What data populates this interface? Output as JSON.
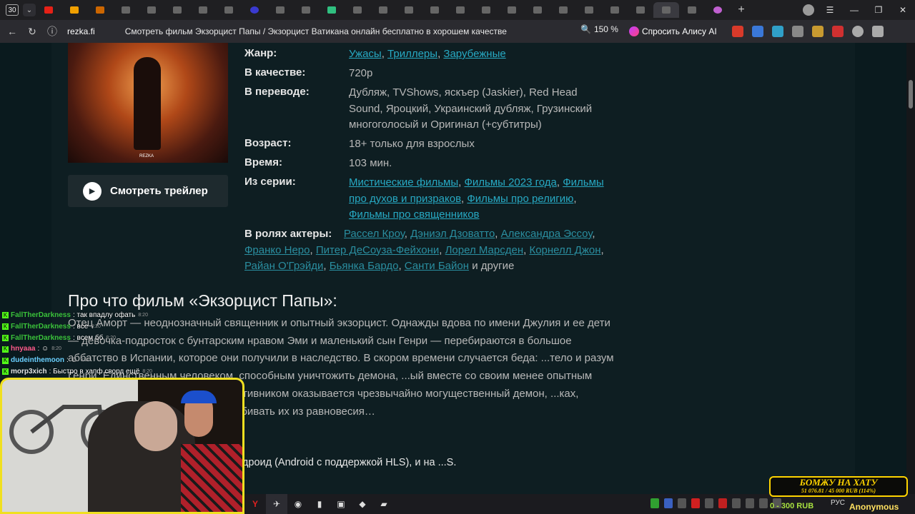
{
  "browser": {
    "tab_count": "30",
    "domain": "rezka.fi",
    "title": "Смотреть фильм Экзорцист Папы / Экзорцист Ватикана онлайн бесплатно в хорошем качестве",
    "zoom": "150 %",
    "alice_label": "Спросить Алису AI"
  },
  "movie": {
    "poster_logo": "REZKA",
    "trailer_label": "Смотреть трейлер",
    "genre_label": "Жанр:",
    "genres": [
      "Ужасы",
      "Триллеры",
      "Зарубежные"
    ],
    "quality_label": "В качестве:",
    "quality": "720p",
    "translation_label": "В переводе:",
    "translation": "Дубляж, TVShows, яскъер (Jaskier), Red Head Sound, Яроцкий, Украинский дубляж, Грузинский многоголосый и Оригинал (+субтитры)",
    "age_label": "Возраст:",
    "age_value": "18+",
    "age_note": "только для взрослых",
    "time_label": "Время:",
    "time": "103 мин.",
    "series_label": "Из серии:",
    "series": [
      "Мистические фильмы",
      "Фильмы 2023 года",
      "Фильмы про духов и призраков",
      "Фильмы про религию",
      "Фильмы про священников"
    ],
    "actors_label": "В ролях актеры:",
    "actors": [
      "Рассел Кроу",
      "Дэниэл Дзоватто",
      "Александра Эссоу",
      "Франко Неро",
      "Питер ДеСоуза-Фейхони",
      "Лорел Марсден",
      "Корнелл Джон",
      "Райан О'Грэйди",
      "Бьянка Бардо",
      "Санти Байон"
    ],
    "actors_more": "и другие",
    "about_title": "Про что фильм «Экзорцист Папы»:",
    "about_text": "Отец Аморт — неоднозначный священник и опытный экзорцист. Однажды вдова по имени Джулия и ее дети — девочка-подросток с бунтарским нравом Эми и маленький сын Генри — перебираются в большое аббатство в Испании, которое они получили в наследство. В скором времени случается беда: ...тело и разум Генри. Единственным человеком, способным уничтожить демона, ...ый вместе со своим менее опытным коллегой начинает ритуал ...их противником оказывается чрезвычайно могущественный демон, ...ках, совершенных священниками, и выбивать их из равновесия…",
    "device_text": "...е и планшете под управлением андроид (Android с поддержкой HLS), и на ...S."
  },
  "chat": [
    {
      "user": "FallTherDarkness",
      "msg": "так впадлу офать",
      "time": "8:20",
      "color": "#3ac23a"
    },
    {
      "user": "FallTherDarkness",
      "msg": "все",
      "time": "8:20",
      "color": "#3ac23a"
    },
    {
      "user": "FallTherDarkness",
      "msg": "всем бб",
      "time": "8:20",
      "color": "#3ac23a"
    },
    {
      "user": "hnyaaa",
      "msg": "",
      "time": "8:20",
      "color": "#ff5a8a"
    },
    {
      "user": "dudeinthemoon",
      "msg": "",
      "time": "8:20",
      "color": "#6ad0ff"
    },
    {
      "user": "morp3xich",
      "msg": "Быстро в хапф сворд ещё",
      "time": "8:20",
      "color": "#e0e0e0"
    }
  ],
  "overlay": {
    "donate_title": "БОМЖУ НА ХАТУ",
    "donate_sub": "51 076.81 / 45 000 RUB (114%)",
    "donate_range": "0 - 300 RUB",
    "anon": "Anonymous"
  },
  "taskbar": {
    "lang": "РУС"
  }
}
